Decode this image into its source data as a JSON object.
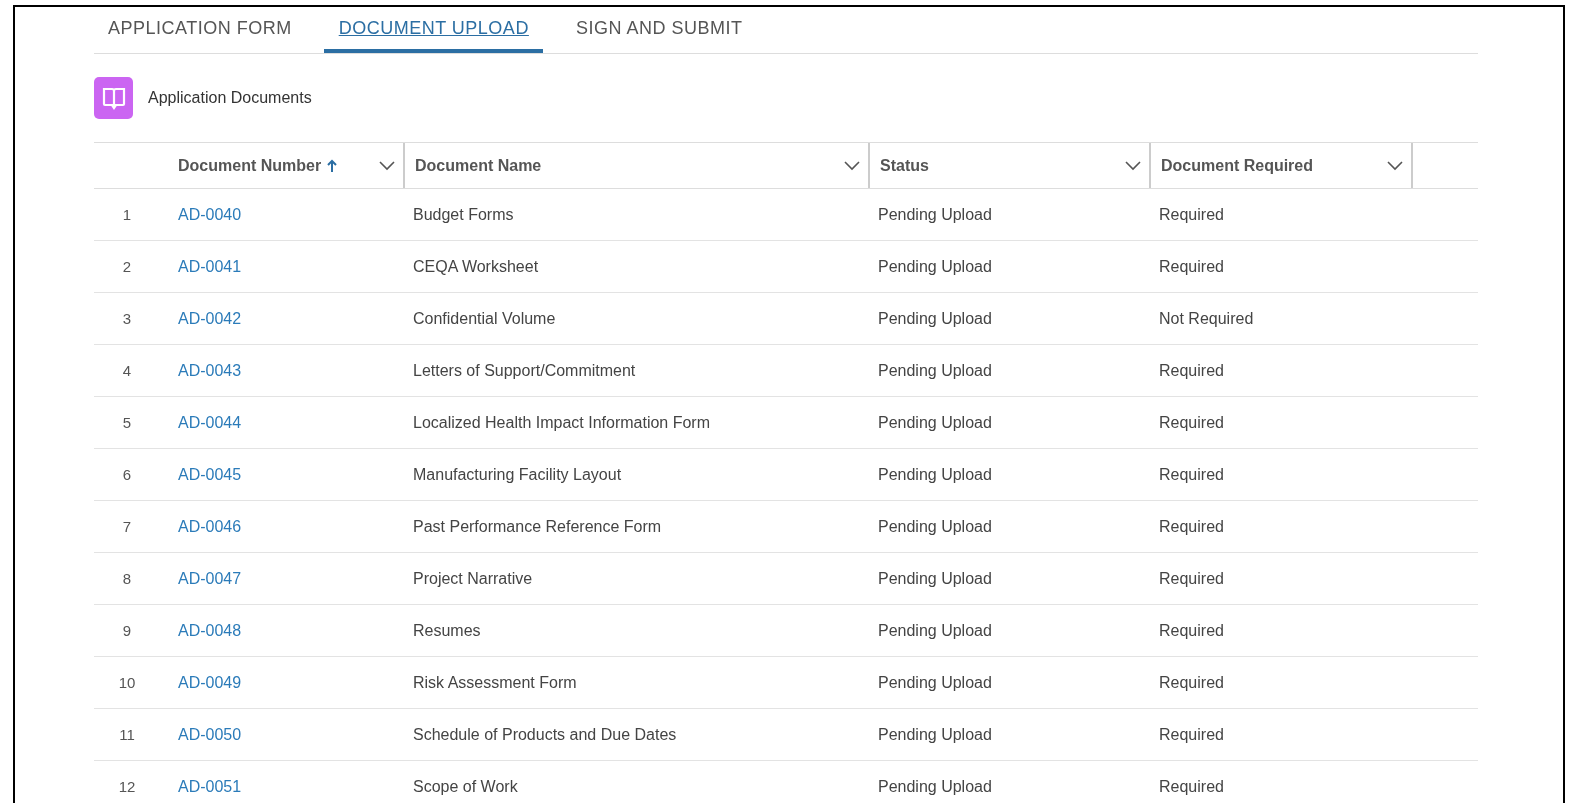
{
  "tabs": [
    {
      "label": "APPLICATION FORM",
      "selected": false
    },
    {
      "label": "DOCUMENT UPLOAD",
      "selected": true
    },
    {
      "label": "SIGN AND SUBMIT",
      "selected": false
    }
  ],
  "card": {
    "title": "Application Documents"
  },
  "table": {
    "columns": [
      {
        "label": "Document Number",
        "sorted": true
      },
      {
        "label": "Document Name",
        "sorted": false
      },
      {
        "label": "Status",
        "sorted": false
      },
      {
        "label": "Document Required",
        "sorted": false
      }
    ],
    "rows": [
      {
        "index": "1",
        "number": "AD-0040",
        "name": "Budget Forms",
        "status": "Pending Upload",
        "required": "Required"
      },
      {
        "index": "2",
        "number": "AD-0041",
        "name": "CEQA Worksheet",
        "status": "Pending Upload",
        "required": "Required"
      },
      {
        "index": "3",
        "number": "AD-0042",
        "name": "Confidential Volume",
        "status": "Pending Upload",
        "required": "Not Required"
      },
      {
        "index": "4",
        "number": "AD-0043",
        "name": "Letters of Support/Commitment",
        "status": "Pending Upload",
        "required": "Required"
      },
      {
        "index": "5",
        "number": "AD-0044",
        "name": "Localized Health Impact Information Form",
        "status": "Pending Upload",
        "required": "Required"
      },
      {
        "index": "6",
        "number": "AD-0045",
        "name": "Manufacturing Facility Layout",
        "status": "Pending Upload",
        "required": "Required"
      },
      {
        "index": "7",
        "number": "AD-0046",
        "name": "Past Performance Reference Form",
        "status": "Pending Upload",
        "required": "Required"
      },
      {
        "index": "8",
        "number": "AD-0047",
        "name": "Project Narrative",
        "status": "Pending Upload",
        "required": "Required"
      },
      {
        "index": "9",
        "number": "AD-0048",
        "name": "Resumes",
        "status": "Pending Upload",
        "required": "Required"
      },
      {
        "index": "10",
        "number": "AD-0049",
        "name": "Risk Assessment Form",
        "status": "Pending Upload",
        "required": "Required"
      },
      {
        "index": "11",
        "number": "AD-0050",
        "name": "Schedule of Products and Due Dates",
        "status": "Pending Upload",
        "required": "Required"
      },
      {
        "index": "12",
        "number": "AD-0051",
        "name": "Scope of Work",
        "status": "Pending Upload",
        "required": "Required"
      }
    ]
  }
}
